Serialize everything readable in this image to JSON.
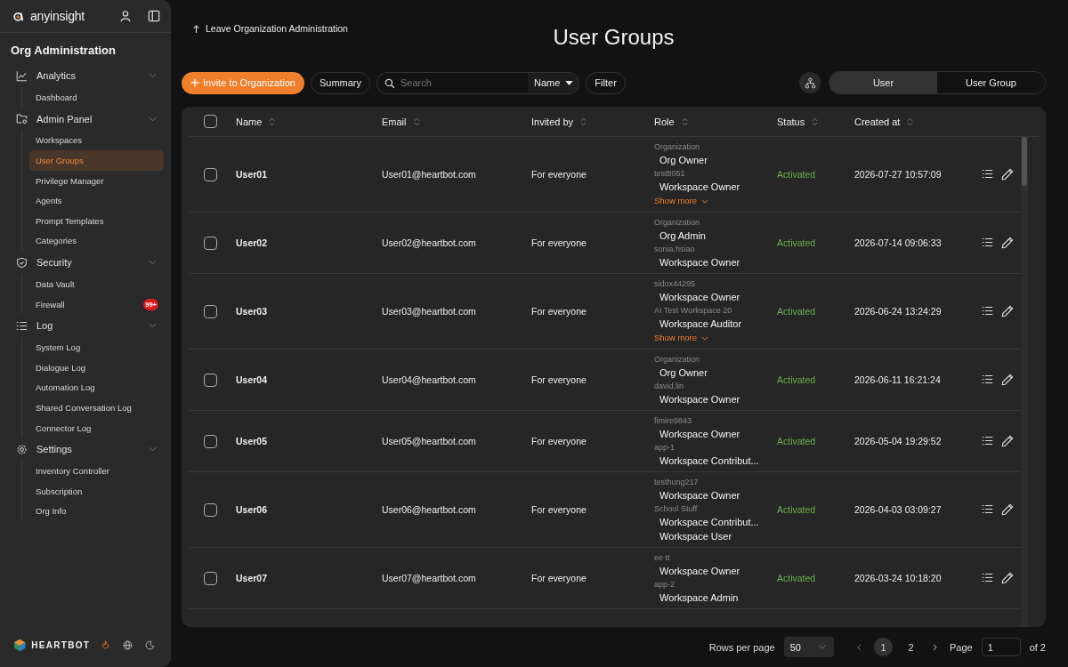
{
  "sidebar": {
    "brand": "anyinsight",
    "title": "Org Administration",
    "sections": [
      {
        "label": "Analytics",
        "expanded": true,
        "items": [
          {
            "label": "Dashboard",
            "selected": false
          }
        ]
      },
      {
        "label": "Admin Panel",
        "expanded": true,
        "items": [
          {
            "label": "Workspaces",
            "selected": false
          },
          {
            "label": "User Groups",
            "selected": true
          },
          {
            "label": "Privilege Manager",
            "selected": false
          },
          {
            "label": "Agents",
            "selected": false
          },
          {
            "label": "Prompt Templates",
            "selected": false
          },
          {
            "label": "Categories",
            "selected": false
          }
        ]
      },
      {
        "label": "Security",
        "expanded": true,
        "items": [
          {
            "label": "Data Vault",
            "selected": false
          },
          {
            "label": "Firewall",
            "selected": false,
            "badge": "99+"
          }
        ]
      },
      {
        "label": "Log",
        "expanded": true,
        "items": [
          {
            "label": "System Log",
            "selected": false
          },
          {
            "label": "Dialogue Log",
            "selected": false
          },
          {
            "label": "Automation Log",
            "selected": false
          },
          {
            "label": "Shared Conversation Log",
            "selected": false
          },
          {
            "label": "Connector Log",
            "selected": false
          }
        ]
      },
      {
        "label": "Settings",
        "expanded": true,
        "items": [
          {
            "label": "Inventory Controller",
            "selected": false
          },
          {
            "label": "Subscription",
            "selected": false
          },
          {
            "label": "Org Info",
            "selected": false
          }
        ]
      }
    ],
    "footer_brand": "HEARTBOT"
  },
  "back_link": "Leave Organization Administration",
  "page_title": "User Groups",
  "toolbar": {
    "invite_button": "Invite to Organization",
    "summary_button": "Summary",
    "search": {
      "placeholder": "Search"
    },
    "search_by": "Name",
    "filter_button": "Filter"
  },
  "view_toggle": [
    {
      "label": "User",
      "selected": true
    },
    {
      "label": "User Group",
      "selected": false
    }
  ],
  "table": {
    "select_all_checked": false,
    "columns": [
      "Name",
      "Email",
      "Invited by",
      "Role",
      "Status",
      "Created at"
    ],
    "rows": [
      {
        "checked": false,
        "name": "User01",
        "email": "User01@heartbot.com",
        "invited_by": "For everyone",
        "roles": [
          {
            "scope": "Organization",
            "roles": [
              "Org Owner"
            ]
          },
          {
            "scope": "test8051",
            "roles": [
              "Workspace Owner"
            ]
          }
        ],
        "show_more": "Show more",
        "status": "Activated",
        "created_at": "2026-07-27 10:57:09"
      },
      {
        "checked": false,
        "name": "User02",
        "email": "User02@heartbot.com",
        "invited_by": "For everyone",
        "roles": [
          {
            "scope": "Organization",
            "roles": [
              "Org Admin"
            ]
          },
          {
            "scope": "sonia.hsiao",
            "roles": [
              "Workspace Owner"
            ]
          }
        ],
        "status": "Activated",
        "created_at": "2026-07-14 09:06:33"
      },
      {
        "checked": false,
        "name": "User03",
        "email": "User03@heartbot.com",
        "invited_by": "For everyone",
        "roles": [
          {
            "scope": "sidox44295",
            "roles": [
              "Workspace Owner"
            ]
          },
          {
            "scope": "AI Test Workspace 20",
            "roles": [
              "Workspace Auditor"
            ]
          }
        ],
        "show_more": "Show more",
        "status": "Activated",
        "created_at": "2026-06-24 13:24:29"
      },
      {
        "checked": false,
        "name": "User04",
        "email": "User04@heartbot.com",
        "invited_by": "For everyone",
        "roles": [
          {
            "scope": "Organization",
            "roles": [
              "Org Owner"
            ]
          },
          {
            "scope": "david.lin",
            "roles": [
              "Workspace Owner"
            ]
          }
        ],
        "status": "Activated",
        "created_at": "2026-06-11 16:21:24"
      },
      {
        "checked": false,
        "name": "User05",
        "email": "User05@heartbot.com",
        "invited_by": "For everyone",
        "roles": [
          {
            "scope": "fimire9843",
            "roles": [
              "Workspace Owner"
            ]
          },
          {
            "scope": "app-1",
            "roles": [
              "Workspace Contribut..."
            ]
          }
        ],
        "status": "Activated",
        "created_at": "2026-05-04 19:29:52"
      },
      {
        "checked": false,
        "name": "User06",
        "email": "User06@heartbot.com",
        "invited_by": "For everyone",
        "roles": [
          {
            "scope": "testhung217",
            "roles": [
              "Workspace Owner"
            ]
          },
          {
            "scope": "School Stuff",
            "roles": [
              "Workspace Contribut...",
              "Workspace User"
            ]
          }
        ],
        "status": "Activated",
        "created_at": "2026-04-03 03:09:27"
      },
      {
        "checked": false,
        "name": "User07",
        "email": "User07@heartbot.com",
        "invited_by": "For everyone",
        "roles": [
          {
            "scope": "ee tt",
            "roles": [
              "Workspace Owner"
            ]
          },
          {
            "scope": "app-2",
            "roles": [
              "Workspace Admin"
            ]
          }
        ],
        "status": "Activated",
        "created_at": "2026-03-24 10:18:20"
      }
    ]
  },
  "pagination": {
    "rows_per_page_label": "Rows per page",
    "rows_per_page": "50",
    "pages": [
      {
        "label": "1",
        "selected": true
      },
      {
        "label": "2",
        "selected": false
      }
    ],
    "page_label": "Page",
    "page_value": "1",
    "page_total": "of 2"
  }
}
